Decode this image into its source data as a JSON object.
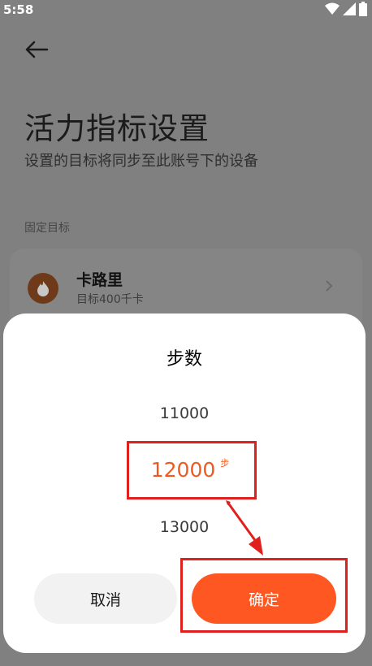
{
  "status_bar": {
    "time": "5:58"
  },
  "header": {
    "title": "活力指标设置",
    "subtitle": "设置的目标将同步至此账号下的设备"
  },
  "section": {
    "label": "固定目标"
  },
  "card": {
    "title": "卡路里",
    "subtitle": "目标400千卡"
  },
  "sheet": {
    "title": "步数",
    "picker": {
      "prev": "11000",
      "selected": "12000",
      "unit": "步",
      "next": "13000"
    },
    "cancel_label": "取消",
    "confirm_label": "确定"
  },
  "colors": {
    "accent": "#ff5722",
    "highlight_box": "#e0201c",
    "selected_text": "#ef5a23"
  }
}
